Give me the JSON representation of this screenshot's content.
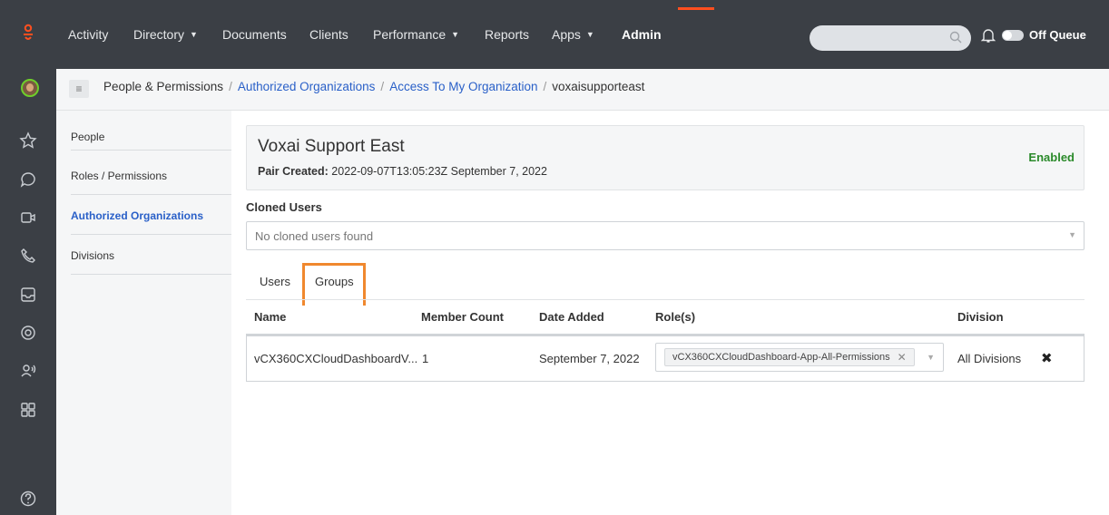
{
  "nav": {
    "items": [
      {
        "label": "Activity",
        "dropdown": false
      },
      {
        "label": "Directory",
        "dropdown": true
      },
      {
        "label": "Documents",
        "dropdown": false
      },
      {
        "label": "Clients",
        "dropdown": false
      },
      {
        "label": "Performance",
        "dropdown": true
      },
      {
        "label": "Reports",
        "dropdown": false
      },
      {
        "label": "Apps",
        "dropdown": true
      },
      {
        "label": "Admin",
        "dropdown": false,
        "active": true
      }
    ],
    "queue_label": "Off Queue",
    "accent_color": "#ff4f1f"
  },
  "breadcrumb": {
    "items": [
      {
        "label": "People & Permissions",
        "link": false
      },
      {
        "label": "Authorized Organizations",
        "link": true
      },
      {
        "label": "Access To My Organization",
        "link": true
      },
      {
        "label": "voxaisupporteast",
        "link": false
      }
    ]
  },
  "subnav": {
    "items": [
      {
        "label": "People"
      },
      {
        "label": "Roles / Permissions"
      },
      {
        "label": "Authorized Organizations",
        "active": true
      },
      {
        "label": "Divisions"
      }
    ]
  },
  "org": {
    "name": "Voxai Support East",
    "pair_label": "Pair Created:",
    "pair_value": "2022-09-07T13:05:23Z September 7, 2022",
    "status": "Enabled"
  },
  "cloned": {
    "title": "Cloned Users",
    "placeholder": "No cloned users found"
  },
  "tabs": {
    "users": "Users",
    "groups": "Groups"
  },
  "table": {
    "headers": {
      "name": "Name",
      "member_count": "Member Count",
      "date_added": "Date Added",
      "roles": "Role(s)",
      "division": "Division"
    },
    "rows": [
      {
        "name": "vCX360CXCloudDashboardV...",
        "member_count": "1",
        "date_added": "September 7, 2022",
        "role_tag": "vCX360CXCloudDashboard-App-All-Permissions",
        "division": "All Divisions"
      }
    ]
  }
}
